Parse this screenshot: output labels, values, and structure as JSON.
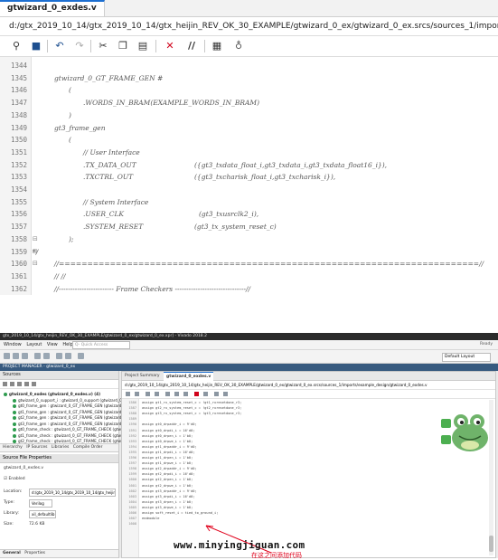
{
  "top_editor": {
    "tab_title": "gtwizard_0_exdes.v",
    "path": "d:/gtx_2019_10_14/gtx_2019_10_14/gtx_heijin_REV_OK_30_EXAMPLE/gtwizard_0_ex/gtwizard_0_ex.srcs/sources_1/imports/example_design/gtwizard_0_exdes.v",
    "toolbar": [
      "save-icon",
      "back-icon",
      "forward-icon",
      "cut-icon",
      "copy-icon",
      "paste-icon",
      "delete-icon",
      "comment-icon",
      "format-icon",
      "bulb-icon"
    ],
    "lines": [
      {
        "n": "1344",
        "fold": "",
        "text": ""
      },
      {
        "n": "1345",
        "fold": "",
        "text": "gtwizard_0_GT_FRAME_GEN #"
      },
      {
        "n": "1346",
        "fold": "",
        "text": "("
      },
      {
        "n": "1347",
        "fold": "",
        "text": ".WORDS_IN_BRAM(EXAMPLE_WORDS_IN_BRAM)"
      },
      {
        "n": "1348",
        "fold": "",
        "text": ")"
      },
      {
        "n": "1349",
        "fold": "",
        "text": "gt3_frame_gen"
      },
      {
        "n": "1350",
        "fold": "",
        "text": "("
      },
      {
        "n": "1351",
        "fold": "",
        "text": "// User Interface"
      },
      {
        "n": "1352",
        "fold": "",
        "text": ".TX_DATA_OUT",
        "right": "({gt3_txdata_float_i,gt3_txdata_i,gt3_txdata_float16_i}),"
      },
      {
        "n": "1353",
        "fold": "",
        "text": ".TXCTRL_OUT",
        "right": "({gt3_txcharisk_float_i,gt3_txcharisk_i}),"
      },
      {
        "n": "1354",
        "fold": "",
        "text": ""
      },
      {
        "n": "1355",
        "fold": "",
        "text": "// System Interface"
      },
      {
        "n": "1356",
        "fold": "",
        "text": ".USER_CLK",
        "right": "(gt3_txusrclk2_i),"
      },
      {
        "n": "1357",
        "fold": "",
        "text": ".SYSTEM_RESET",
        "right": "(gt3_tx_system_reset_c)"
      },
      {
        "n": "1358",
        "fold": "⊟",
        "text": ");"
      },
      {
        "n": "1359",
        "fold": "⊟",
        "text": "*/"
      },
      {
        "n": "1360",
        "fold": "⊟",
        "text": "//==========================================================================//"
      },
      {
        "n": "1361",
        "fold": "",
        "text": "//                                                                          //"
      },
      {
        "n": "1362",
        "fold": "",
        "text": "//------------------------  Frame Checkers  -------------------------------//"
      }
    ]
  },
  "vivado": {
    "title_bar": "gtx_2019_10_14/gtx_heijin_REV_OK_30_EXAMPLE/gtwizard_0_ex/gtwizard_0_ex.xpr] - Vivado 2018.2",
    "menus": [
      "Window",
      "Layout",
      "View",
      "Help"
    ],
    "search_placeholder": "Q- Quick Access",
    "status": "Ready",
    "layout_select": "Default Layout",
    "project_manager": "PROJECT MANAGER - gtwizard_0_ex",
    "sources_header": "Sources",
    "tree": [
      "gtwizard_0_exdes (gtwizard_0_exdes.v) (4)",
      "gtwizard_0_support_i : gtwizard_0_support (gtwizard_0",
      "gt0_frame_gen : gtwizard_0_GT_FRAME_GEN (gtwizard_0",
      "gt1_frame_gen : gtwizard_0_GT_FRAME_GEN (gtwizard_0",
      "gt2_frame_gen : gtwizard_0_GT_FRAME_GEN (gtwizard_0",
      "gt3_frame_gen : gtwizard_0_GT_FRAME_GEN (gtwizard_0",
      "gt0_frame_check : gtwizard_0_GT_FRAME_CHECK (gtw",
      "gt1_frame_check : gtwizard_0_GT_FRAME_CHECK (gtw",
      "gt2_frame_check : gtwizard_0_GT_FRAME_CHECK (gtw"
    ],
    "left_tabs": [
      "Hierarchy",
      "IP Sources",
      "Libraries",
      "Compile Order"
    ],
    "sfp_header": "Source File Properties",
    "sfp_file": "gtwizard_0_exdes.v",
    "props": {
      "enabled": "Enabled",
      "location_label": "Location:",
      "location_value": "d:/gtx_2019_10_14/gtx_2019_10_14/gtx_heijin_REV_",
      "type_label": "Type:",
      "type_value": "Verilog",
      "library_label": "Library:",
      "library_value": "xil_defaultlib",
      "size_label": "Size:",
      "size_value": "72.6 KB"
    },
    "bottom_tabs": [
      "General",
      "Properties"
    ],
    "right_tabs": [
      "Project Summary",
      "gtwizard_0_exdes.v"
    ],
    "right_path": "d:/gtx_2019_10_14/gtx_2019_10_14/gtx_heijin_REV_OK_30_EXAMPLE/gtwizard_0_ex/gtwizard_0_ex.srcs/sources_1/imports/example_design/gtwizard_0_exdes.v",
    "code_lines": [
      {
        "n": "1586",
        "t": "    assign  gt1_rx_system_reset_c = !gt1_rxresetdone_r3;"
      },
      {
        "n": "1587",
        "t": "    assign  gt2_rx_system_reset_c = !gt2_rxresetdone_r3;"
      },
      {
        "n": "1588",
        "t": "    assign  gt3_rx_system_reset_c = !gt3_rxresetdone_r3;"
      },
      {
        "n": "1589",
        "t": ""
      },
      {
        "n": "1590",
        "t": "assign gt0_drpaddr_i = 9'd0;"
      },
      {
        "n": "1591",
        "t": "assign gt0_drpdi_i = 16'd0;"
      },
      {
        "n": "1592",
        "t": "assign gt0_drpen_i = 1'b0;"
      },
      {
        "n": "1593",
        "t": "assign gt0_drpwe_i = 1'b0;"
      },
      {
        "n": "1594",
        "t": "assign gt1_drpaddr_i = 9'd0;"
      },
      {
        "n": "1595",
        "t": "assign gt1_drpdi_i = 16'd0;"
      },
      {
        "n": "1596",
        "t": "assign gt1_drpen_i = 1'b0;"
      },
      {
        "n": "1597",
        "t": "assign gt1_drpwe_i = 1'b0;"
      },
      {
        "n": "1598",
        "t": "assign gt2_drpaddr_i = 9'd0;"
      },
      {
        "n": "1599",
        "t": "assign gt2_drpdi_i = 16'd0;"
      },
      {
        "n": "1600",
        "t": "assign gt2_drpen_i = 1'b0;"
      },
      {
        "n": "1601",
        "t": "assign gt2_drpwe_i = 1'b0;"
      },
      {
        "n": "1602",
        "t": "assign gt3_drpaddr_i = 9'd0;"
      },
      {
        "n": "1603",
        "t": "assign gt3_drpdi_i = 16'd0;"
      },
      {
        "n": "1604",
        "t": "assign gt3_drpen_i = 1'b0;"
      },
      {
        "n": "1605",
        "t": "assign gt3_drpwe_i = 1'b0;"
      },
      {
        "n": "1606",
        "t": "assign soft_reset_i = tied_to_ground_i;"
      },
      {
        "n": "1607",
        "t": "endmodule"
      },
      {
        "n": "1608",
        "t": ""
      }
    ]
  },
  "watermark": "www.minyingjiguan.com",
  "annotation": "在这之间添加代码",
  "colors": {
    "accent": "#1d6fd1",
    "annotation": "#e0001b",
    "frog": "#5fa55a",
    "keyword": "#8a2be2"
  }
}
